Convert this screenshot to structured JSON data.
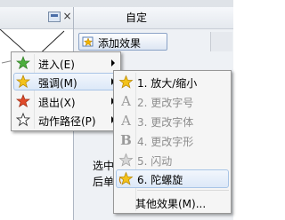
{
  "animation_pane": {
    "title": "自定",
    "add_effect_label": "添加效果",
    "body_text_line1": "选中",
    "body_text_line2": "后单"
  },
  "context_menu": {
    "items": [
      {
        "label": "进入(E)",
        "icon": "green-star-icon",
        "has_submenu": true
      },
      {
        "label": "强调(M)",
        "icon": "yellow-star-icon",
        "has_submenu": true,
        "highlighted": true
      },
      {
        "label": "退出(X)",
        "icon": "red-star-icon",
        "has_submenu": true
      },
      {
        "label": "动作路径(P)",
        "icon": "outline-star-icon",
        "has_submenu": true
      }
    ]
  },
  "emphasis_submenu": {
    "items": [
      {
        "label": "1. 放大/缩小",
        "icon": "grow-shrink-icon",
        "enabled": true
      },
      {
        "label": "2. 更改字号",
        "icon": "change-font-size-icon",
        "enabled": false
      },
      {
        "label": "3. 更改字体",
        "icon": "change-font-icon",
        "enabled": false
      },
      {
        "label": "4. 更改字形",
        "icon": "change-font-style-icon",
        "enabled": false
      },
      {
        "label": "5. 闪动",
        "icon": "flicker-icon",
        "enabled": false
      },
      {
        "label": "6. 陀螺旋",
        "icon": "spin-icon",
        "enabled": true,
        "highlighted": true
      }
    ],
    "more_effects_label": "其他效果(M)..."
  },
  "colors": {
    "highlight_border": "#a8c4e6",
    "highlight_fill": "#dce8f8",
    "disabled_text": "#8d8d8d"
  }
}
